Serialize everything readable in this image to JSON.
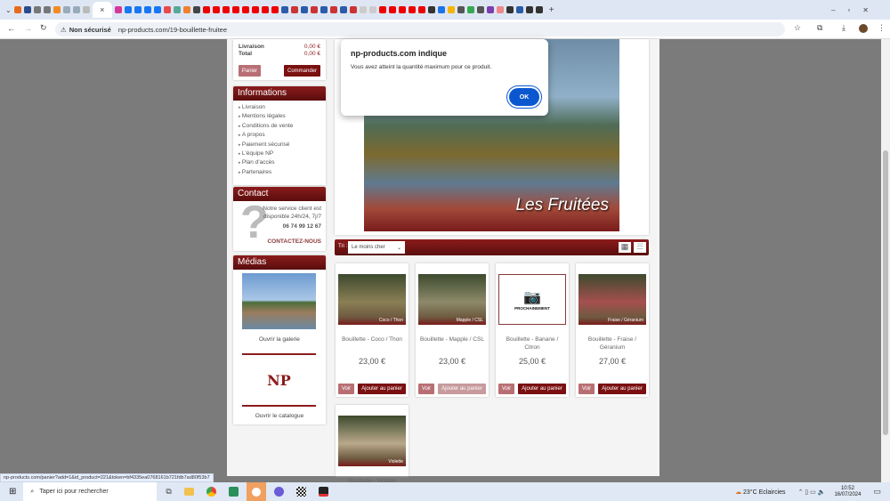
{
  "browser": {
    "tab_close": "×",
    "security": "Non sécurisé",
    "url": "np-products.com/19-bouillette-fruitee",
    "status_url": "np-products.com/panier?add=1&id_product=221&token=bf4335ea0768161b721fdb7ad80f53b7"
  },
  "cart": {
    "rows": [
      {
        "label": "Livraison",
        "value": "0,00 €"
      },
      {
        "label": "Total",
        "value": "0,00 €"
      }
    ],
    "panier": "Panier",
    "commander": "Commander"
  },
  "informations": {
    "title": "Informations",
    "items": [
      "Livraison",
      "Mentions légales",
      "Conditions de vente",
      "A propos",
      "Paiement sécurisé",
      "L'équipe NP",
      "Plan d'accès",
      "Partenaires"
    ]
  },
  "contact": {
    "title": "Contact",
    "line1": "Notre service client est",
    "line2": "disponible 24h/24, 7j/7",
    "phone": "06 74 99 12 67",
    "cta": "CONTACTEZ-NOUS"
  },
  "medias": {
    "title": "Médias",
    "gallery": "Ouvrir la galerie",
    "catalogue": "Ouvrir le catalogue",
    "logo": "NP Products"
  },
  "banner": {
    "text": "Les Fruitées",
    "logo": "NP Products"
  },
  "sort": {
    "label": "Tri :",
    "value": "Le moins cher"
  },
  "products": [
    {
      "name": "Bouillette - Coco / Thon",
      "price": "23,00 €",
      "tag": "Coco / Thon",
      "img": "#8a7f55"
    },
    {
      "name": "Bouillette - Mapple / CSL",
      "price": "23,00 €",
      "tag": "Mapple / CSL",
      "img": "#8d8a6a"
    },
    {
      "name": "Bouillette - Banane / Citron",
      "price": "25,00 €",
      "tag": "PROCHAINEMENT",
      "img": "#ffffff"
    },
    {
      "name": "Bouillette - Fraise / Géranium",
      "price": "27,00 €",
      "tag": "Fraise / Géranium",
      "img": "#a5504f"
    },
    {
      "name": "Bouillette - Violette",
      "price": "",
      "tag": "Violette",
      "img": "#b9a98a"
    }
  ],
  "product_buttons": {
    "view": "Voir",
    "add": "Ajouter au panier"
  },
  "dialog": {
    "title": "np-products.com indique",
    "message": "Vous avez atteint la quantité maximum pour ce produit.",
    "ok": "OK"
  },
  "taskbar": {
    "search": "Taper ici pour rechercher",
    "weather": "23°C  Eclaircies",
    "time": "10:52",
    "date": "16/07/2024"
  }
}
